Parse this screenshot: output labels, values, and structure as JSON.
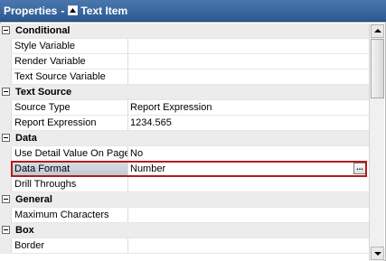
{
  "titlebar": {
    "title": "Properties",
    "separator": "-",
    "item_label": "Text Item"
  },
  "rows": [
    {
      "type": "category",
      "label": "Conditional"
    },
    {
      "type": "property",
      "name": "Style Variable",
      "value": ""
    },
    {
      "type": "property",
      "name": "Render Variable",
      "value": ""
    },
    {
      "type": "property",
      "name": "Text Source Variable",
      "value": ""
    },
    {
      "type": "category",
      "label": "Text Source"
    },
    {
      "type": "property",
      "name": "Source Type",
      "value": "Report Expression"
    },
    {
      "type": "property",
      "name": "Report Expression",
      "value": "1234.565"
    },
    {
      "type": "category",
      "label": "Data"
    },
    {
      "type": "property",
      "name": "Use Detail Value On Page",
      "value": "No"
    },
    {
      "type": "property",
      "name": "Data Format",
      "value": "Number",
      "selected": true,
      "button": "..."
    },
    {
      "type": "property",
      "name": "Drill Throughs",
      "value": ""
    },
    {
      "type": "category",
      "label": "General"
    },
    {
      "type": "property",
      "name": "Maximum Characters",
      "value": ""
    },
    {
      "type": "category",
      "label": "Box"
    },
    {
      "type": "property",
      "name": "Border",
      "value": ""
    }
  ],
  "colors": {
    "title_bar": "#3a6aa0",
    "highlight_border": "#b31b1b"
  }
}
